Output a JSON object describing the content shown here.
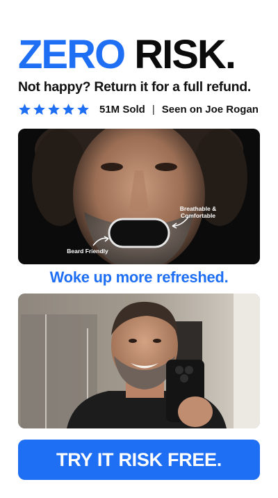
{
  "headline": {
    "part1": "ZERO",
    "part2": "RISK."
  },
  "subheadline": "Not happy? Return it for a full refund.",
  "rating": {
    "stars": 5,
    "sold": "51M Sold",
    "separator": "|",
    "seen_on": "Seen on Joe Rogan"
  },
  "product_photo": {
    "label_breathable": "Breathable & Comfortable",
    "label_beard": "Beard Friendly"
  },
  "caption": "Woke up more refreshed.",
  "cta": {
    "label": "TRY IT RISK FREE."
  },
  "colors": {
    "accent": "#1f6ff5",
    "text": "#111111"
  }
}
